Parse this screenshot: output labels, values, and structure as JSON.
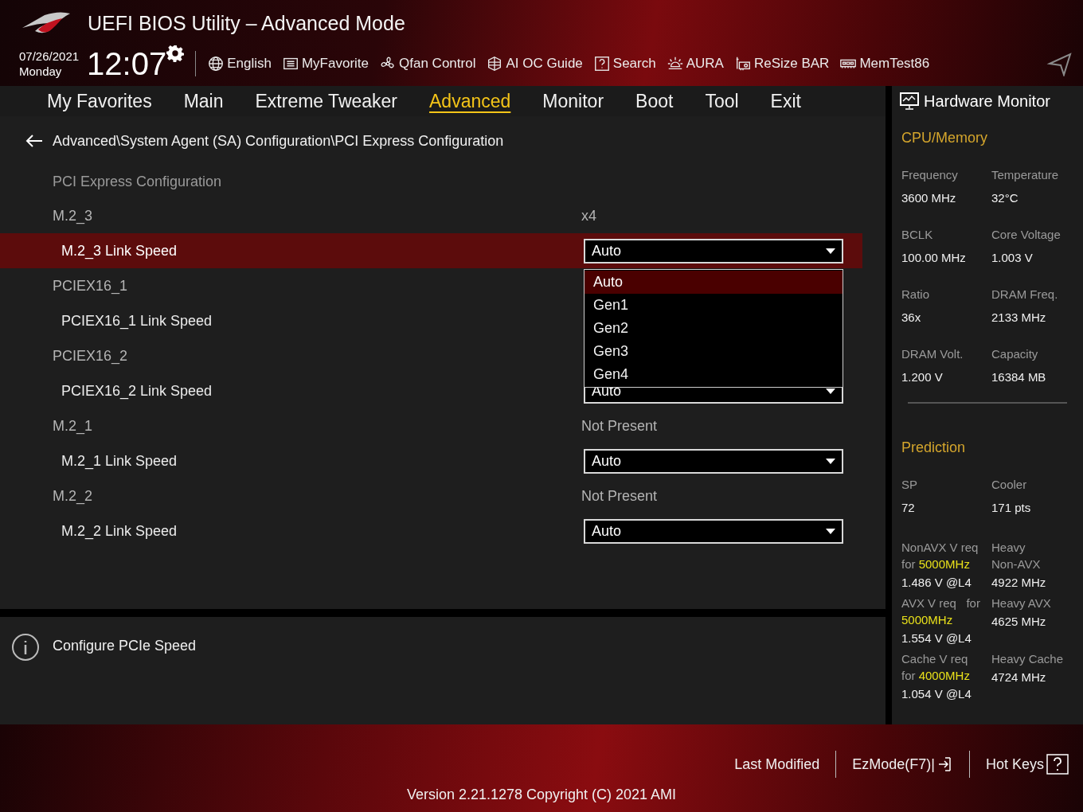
{
  "header": {
    "title": "UEFI BIOS Utility – Advanced Mode",
    "date": "07/26/2021",
    "day": "Monday",
    "time": "12:07",
    "tools": [
      {
        "kind": "globe",
        "label": "English"
      },
      {
        "kind": "list",
        "label": "MyFavorite"
      },
      {
        "kind": "fan",
        "label": "Qfan Control"
      },
      {
        "kind": "chip",
        "label": "AI OC Guide"
      },
      {
        "kind": "help",
        "label": "Search"
      },
      {
        "kind": "light",
        "label": "AURA"
      },
      {
        "kind": "card",
        "label": "ReSize BAR"
      },
      {
        "kind": "memory",
        "label": "MemTest86"
      }
    ]
  },
  "tabs": [
    {
      "label": "My Favorites",
      "selected": false
    },
    {
      "label": "Main",
      "selected": false
    },
    {
      "label": "Extreme Tweaker",
      "selected": false
    },
    {
      "label": "Advanced",
      "selected": true
    },
    {
      "label": "Monitor",
      "selected": false
    },
    {
      "label": "Boot",
      "selected": false
    },
    {
      "label": "Tool",
      "selected": false
    },
    {
      "label": "Exit",
      "selected": false
    }
  ],
  "breadcrumb": "Advanced\\System Agent (SA) Configuration\\PCI Express Configuration",
  "items": [
    {
      "kind": "title",
      "label": "PCI Express Configuration",
      "selected": false
    },
    {
      "kind": "info",
      "label": "M.2_3",
      "value": "x4",
      "selected": false
    },
    {
      "kind": "select",
      "label": "M.2_3 Link Speed",
      "value": "Auto",
      "selected": true,
      "options": [
        {
          "label": "Auto",
          "selected": true
        },
        {
          "label": "Gen1",
          "selected": false
        },
        {
          "label": "Gen2",
          "selected": false
        },
        {
          "label": "Gen3",
          "selected": false
        },
        {
          "label": "Gen4",
          "selected": false
        }
      ]
    },
    {
      "kind": "info",
      "label": "PCIEX16_1",
      "selected": false
    },
    {
      "kind": "select",
      "label": "PCIEX16_1 Link Speed",
      "selected": false
    },
    {
      "kind": "info",
      "label": "PCIEX16_2",
      "selected": false
    },
    {
      "kind": "select",
      "label": "PCIEX16_2 Link Speed",
      "value": "Auto",
      "selected": false
    },
    {
      "kind": "info",
      "label": "M.2_1",
      "value": "Not Present",
      "selected": false
    },
    {
      "kind": "select",
      "label": "M.2_1 Link Speed",
      "value": "Auto",
      "selected": false
    },
    {
      "kind": "info",
      "label": "M.2_2",
      "value": "Not Present",
      "selected": false
    },
    {
      "kind": "select",
      "label": "M.2_2 Link Speed",
      "value": "Auto",
      "selected": false
    }
  ],
  "help": "Configure PCIe Speed",
  "hardware_monitor": {
    "title": "Hardware Monitor",
    "cpu_memory": {
      "title": "CPU/Memory",
      "readings": [
        {
          "label": "Frequency",
          "value": "3600 MHz"
        },
        {
          "label": "Temperature",
          "value": "32°C"
        },
        {
          "label": "BCLK",
          "value": "100.00 MHz"
        },
        {
          "label": "Core Voltage",
          "value": "1.003 V"
        },
        {
          "label": "Ratio",
          "value": "36x"
        },
        {
          "label": "DRAM Freq.",
          "value": "2133 MHz"
        },
        {
          "label": "DRAM Volt.",
          "value": "1.200 V"
        },
        {
          "label": "Capacity",
          "value": "16384 MB"
        }
      ]
    },
    "prediction": {
      "title": "Prediction",
      "readings": [
        {
          "lines": [
            [
              {
                "text": "SP"
              }
            ]
          ],
          "value": "72"
        },
        {
          "lines": [
            [
              {
                "text": "Cooler"
              }
            ]
          ],
          "value": "171 pts"
        },
        {
          "lines": [
            [
              {
                "text": "NonAVX V req"
              }
            ],
            [
              {
                "text": "for "
              },
              {
                "text": "5000MHz",
                "highlight": true
              }
            ]
          ],
          "value": "1.486 V @L4"
        },
        {
          "lines": [
            [
              {
                "text": "Heavy"
              }
            ],
            [
              {
                "text": "Non-AVX"
              }
            ]
          ],
          "value": "4922 MHz"
        },
        {
          "lines": [
            [
              {
                "text": "AVX V req   for"
              }
            ],
            [
              {
                "text": "5000MHz",
                "highlight": true
              }
            ]
          ],
          "value": "1.554 V @L4"
        },
        {
          "lines": [
            [
              {
                "text": "Heavy AVX"
              }
            ]
          ],
          "value": "4625 MHz"
        },
        {
          "lines": [
            [
              {
                "text": "Cache V req"
              }
            ],
            [
              {
                "text": "for "
              },
              {
                "text": "4000MHz",
                "highlight": true
              }
            ]
          ],
          "value": "1.054 V @L4"
        },
        {
          "lines": [
            [
              {
                "text": "Heavy Cache"
              }
            ]
          ],
          "value": "4724 MHz"
        }
      ]
    }
  },
  "footer": {
    "buttons": [
      {
        "kind": "text",
        "label": "Last Modified"
      },
      {
        "kind": "exit",
        "label": "EzMode(F7)|"
      },
      {
        "kind": "help",
        "label": "Hot Keys"
      }
    ],
    "version": "Version 2.21.1278 Copyright (C) 2021 AMI"
  }
}
